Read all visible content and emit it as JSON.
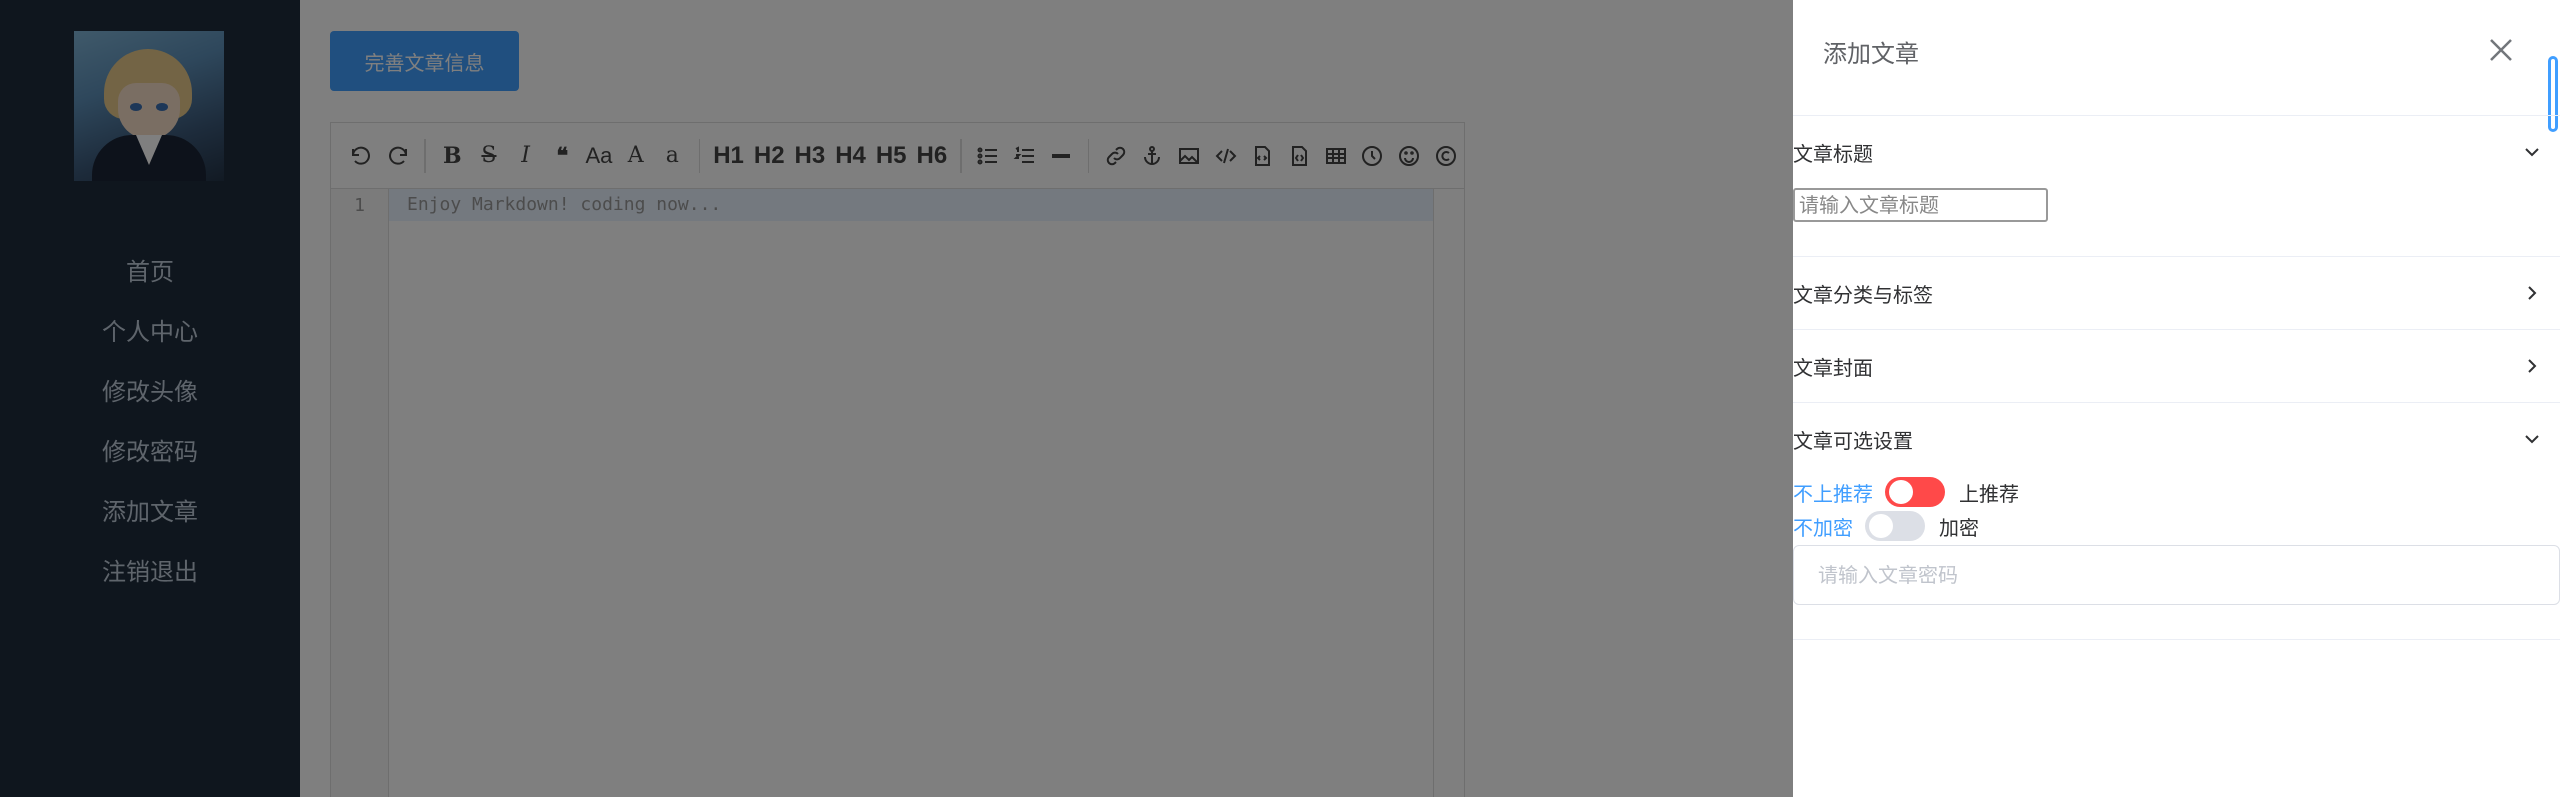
{
  "sidebar": {
    "avatar": "avatar",
    "items": [
      {
        "label": "首页"
      },
      {
        "label": "个人中心"
      },
      {
        "label": "修改头像"
      },
      {
        "label": "修改密码"
      },
      {
        "label": "添加文章"
      },
      {
        "label": "注销退出"
      }
    ]
  },
  "main": {
    "complete_button": "完善文章信息",
    "editor": {
      "toolbar": [
        "undo",
        "redo",
        "bold",
        "strikethrough",
        "italic",
        "quote",
        "uppercase",
        "A",
        "a",
        "H1",
        "H2",
        "H3",
        "H4",
        "H5",
        "H6",
        "list-ul",
        "list-ol",
        "hr",
        "link",
        "anchor",
        "image",
        "code",
        "preformatted",
        "code-block",
        "table",
        "datetime",
        "emoji",
        "html-entities"
      ],
      "headings": [
        "H1",
        "H2",
        "H3",
        "H4",
        "H5",
        "H6"
      ],
      "line_number": "1",
      "placeholder": "Enjoy Markdown! coding now..."
    }
  },
  "drawer": {
    "title": "添加文章",
    "sections": {
      "title_section": {
        "label": "文章标题",
        "input_placeholder": "请输入文章标题"
      },
      "category_section": {
        "label": "文章分类与标签"
      },
      "cover_section": {
        "label": "文章封面"
      },
      "options_section": {
        "label": "文章可选设置",
        "recommend": {
          "off_label": "不上推荐",
          "on_label": "上推荐",
          "state": "on"
        },
        "encrypt": {
          "off_label": "不加密",
          "on_label": "加密",
          "state": "off"
        },
        "password_placeholder": "请输入文章密码"
      }
    }
  },
  "colors": {
    "sidebar_bg": "#1f2d3d",
    "primary": "#409eff",
    "switch_on": "#ff4949",
    "switch_off": "#dcdfe6"
  }
}
